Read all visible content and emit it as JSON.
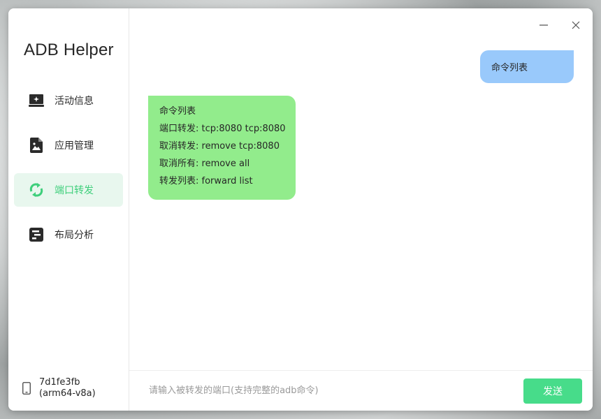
{
  "app": {
    "title": "ADB Helper"
  },
  "sidebar": {
    "items": [
      {
        "label": "活动信息",
        "icon": "laptop-star-icon",
        "active": false
      },
      {
        "label": "应用管理",
        "icon": "file-image-icon",
        "active": false
      },
      {
        "label": "端口转发",
        "icon": "sync-arrows-icon",
        "active": true
      },
      {
        "label": "布局分析",
        "icon": "layout-bars-icon",
        "active": false
      }
    ]
  },
  "device": {
    "serial": "7d1fe3fb",
    "abi": "(arm64-v8a)",
    "icon": "phone-icon"
  },
  "window_controls": {
    "minimize_icon": "minimize-icon",
    "close_icon": "close-icon"
  },
  "chat": {
    "user_message": "命令列表",
    "reply_lines": [
      "命令列表",
      "端口转发: tcp:8080  tcp:8080",
      "取消转发: remove tcp:8080",
      "取消所有: remove all",
      "转发列表: forward list"
    ]
  },
  "input": {
    "value": "",
    "placeholder": "请输入被转发的端口(支持完整的adb命令)",
    "send_label": "发送"
  },
  "colors": {
    "accent": "#47dc8a",
    "active_bg": "#e8f7ee",
    "active_text": "#3ecf7b",
    "user_bubble": "#99c9fb",
    "reply_bubble": "#92ec8c"
  }
}
